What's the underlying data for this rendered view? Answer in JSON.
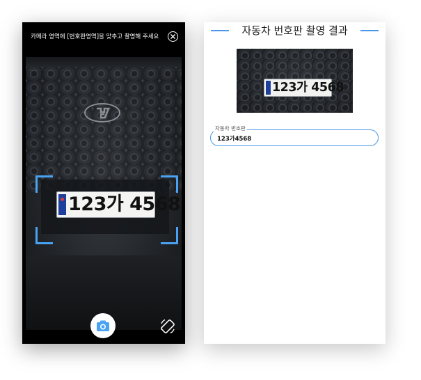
{
  "camera_screen": {
    "instruction": "카메라 영역에 [번호판영역]을 맞추고 촬영해 주세요",
    "plate_number": "123가 4568",
    "icons": [
      "close-icon",
      "camera-icon",
      "rotate-icon",
      "hyundai-logo"
    ],
    "accent_color": "#4aa3f2"
  },
  "result_screen": {
    "title": "자동차 번호판 촬영 결과",
    "thumbnail_plate": "123가 4568",
    "field_label": "자동차 번호판",
    "field_value": "123가4568",
    "accent_color": "#4a97e8"
  }
}
